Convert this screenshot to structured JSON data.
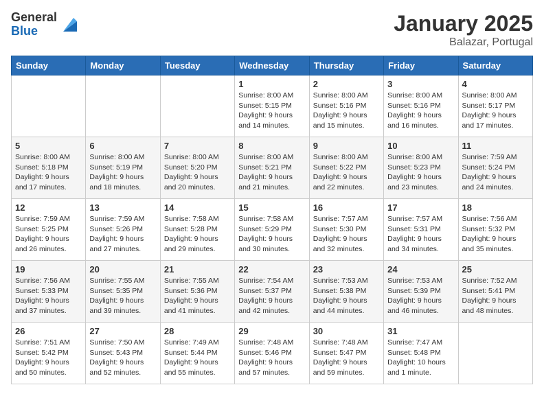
{
  "header": {
    "logo_general": "General",
    "logo_blue": "Blue",
    "month": "January 2025",
    "location": "Balazar, Portugal"
  },
  "weekdays": [
    "Sunday",
    "Monday",
    "Tuesday",
    "Wednesday",
    "Thursday",
    "Friday",
    "Saturday"
  ],
  "weeks": [
    [
      {
        "day": "",
        "info": ""
      },
      {
        "day": "",
        "info": ""
      },
      {
        "day": "",
        "info": ""
      },
      {
        "day": "1",
        "info": "Sunrise: 8:00 AM\nSunset: 5:15 PM\nDaylight: 9 hours\nand 14 minutes."
      },
      {
        "day": "2",
        "info": "Sunrise: 8:00 AM\nSunset: 5:16 PM\nDaylight: 9 hours\nand 15 minutes."
      },
      {
        "day": "3",
        "info": "Sunrise: 8:00 AM\nSunset: 5:16 PM\nDaylight: 9 hours\nand 16 minutes."
      },
      {
        "day": "4",
        "info": "Sunrise: 8:00 AM\nSunset: 5:17 PM\nDaylight: 9 hours\nand 17 minutes."
      }
    ],
    [
      {
        "day": "5",
        "info": "Sunrise: 8:00 AM\nSunset: 5:18 PM\nDaylight: 9 hours\nand 17 minutes."
      },
      {
        "day": "6",
        "info": "Sunrise: 8:00 AM\nSunset: 5:19 PM\nDaylight: 9 hours\nand 18 minutes."
      },
      {
        "day": "7",
        "info": "Sunrise: 8:00 AM\nSunset: 5:20 PM\nDaylight: 9 hours\nand 20 minutes."
      },
      {
        "day": "8",
        "info": "Sunrise: 8:00 AM\nSunset: 5:21 PM\nDaylight: 9 hours\nand 21 minutes."
      },
      {
        "day": "9",
        "info": "Sunrise: 8:00 AM\nSunset: 5:22 PM\nDaylight: 9 hours\nand 22 minutes."
      },
      {
        "day": "10",
        "info": "Sunrise: 8:00 AM\nSunset: 5:23 PM\nDaylight: 9 hours\nand 23 minutes."
      },
      {
        "day": "11",
        "info": "Sunrise: 7:59 AM\nSunset: 5:24 PM\nDaylight: 9 hours\nand 24 minutes."
      }
    ],
    [
      {
        "day": "12",
        "info": "Sunrise: 7:59 AM\nSunset: 5:25 PM\nDaylight: 9 hours\nand 26 minutes."
      },
      {
        "day": "13",
        "info": "Sunrise: 7:59 AM\nSunset: 5:26 PM\nDaylight: 9 hours\nand 27 minutes."
      },
      {
        "day": "14",
        "info": "Sunrise: 7:58 AM\nSunset: 5:28 PM\nDaylight: 9 hours\nand 29 minutes."
      },
      {
        "day": "15",
        "info": "Sunrise: 7:58 AM\nSunset: 5:29 PM\nDaylight: 9 hours\nand 30 minutes."
      },
      {
        "day": "16",
        "info": "Sunrise: 7:57 AM\nSunset: 5:30 PM\nDaylight: 9 hours\nand 32 minutes."
      },
      {
        "day": "17",
        "info": "Sunrise: 7:57 AM\nSunset: 5:31 PM\nDaylight: 9 hours\nand 34 minutes."
      },
      {
        "day": "18",
        "info": "Sunrise: 7:56 AM\nSunset: 5:32 PM\nDaylight: 9 hours\nand 35 minutes."
      }
    ],
    [
      {
        "day": "19",
        "info": "Sunrise: 7:56 AM\nSunset: 5:33 PM\nDaylight: 9 hours\nand 37 minutes."
      },
      {
        "day": "20",
        "info": "Sunrise: 7:55 AM\nSunset: 5:35 PM\nDaylight: 9 hours\nand 39 minutes."
      },
      {
        "day": "21",
        "info": "Sunrise: 7:55 AM\nSunset: 5:36 PM\nDaylight: 9 hours\nand 41 minutes."
      },
      {
        "day": "22",
        "info": "Sunrise: 7:54 AM\nSunset: 5:37 PM\nDaylight: 9 hours\nand 42 minutes."
      },
      {
        "day": "23",
        "info": "Sunrise: 7:53 AM\nSunset: 5:38 PM\nDaylight: 9 hours\nand 44 minutes."
      },
      {
        "day": "24",
        "info": "Sunrise: 7:53 AM\nSunset: 5:39 PM\nDaylight: 9 hours\nand 46 minutes."
      },
      {
        "day": "25",
        "info": "Sunrise: 7:52 AM\nSunset: 5:41 PM\nDaylight: 9 hours\nand 48 minutes."
      }
    ],
    [
      {
        "day": "26",
        "info": "Sunrise: 7:51 AM\nSunset: 5:42 PM\nDaylight: 9 hours\nand 50 minutes."
      },
      {
        "day": "27",
        "info": "Sunrise: 7:50 AM\nSunset: 5:43 PM\nDaylight: 9 hours\nand 52 minutes."
      },
      {
        "day": "28",
        "info": "Sunrise: 7:49 AM\nSunset: 5:44 PM\nDaylight: 9 hours\nand 55 minutes."
      },
      {
        "day": "29",
        "info": "Sunrise: 7:48 AM\nSunset: 5:46 PM\nDaylight: 9 hours\nand 57 minutes."
      },
      {
        "day": "30",
        "info": "Sunrise: 7:48 AM\nSunset: 5:47 PM\nDaylight: 9 hours\nand 59 minutes."
      },
      {
        "day": "31",
        "info": "Sunrise: 7:47 AM\nSunset: 5:48 PM\nDaylight: 10 hours\nand 1 minute."
      },
      {
        "day": "",
        "info": ""
      }
    ]
  ]
}
